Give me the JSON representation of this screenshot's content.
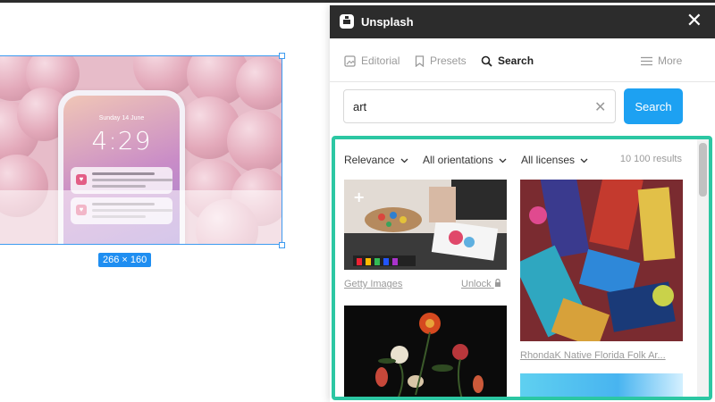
{
  "canvas": {
    "frame_size_label": "266 × 160",
    "phone": {
      "date": "Sunday 14 June",
      "time": "4:29"
    }
  },
  "panel": {
    "title": "Unsplash",
    "close_label": "✕",
    "tabs": [
      {
        "label": "Editorial",
        "icon": "image-icon",
        "active": false
      },
      {
        "label": "Presets",
        "icon": "bookmark-icon",
        "active": false
      },
      {
        "label": "Search",
        "icon": "search-icon",
        "active": true
      },
      {
        "label": "More",
        "icon": "menu-icon",
        "active": false
      }
    ],
    "search": {
      "value": "art",
      "placeholder": "",
      "button_label": "Search"
    },
    "filters": {
      "relevance": "Relevance",
      "orientation": "All orientations",
      "license": "All licenses",
      "results_count": "10 100 results"
    },
    "results": [
      {
        "caption": "Getty Images",
        "extra": "Unlock"
      },
      {
        "caption": "RhondaK Native Florida Folk Ar..."
      }
    ]
  },
  "colors": {
    "accent": "#1da1f2",
    "highlight_border": "#2cc7a3",
    "header_bg": "#2c2c2c",
    "selection": "#3d9bf0"
  }
}
